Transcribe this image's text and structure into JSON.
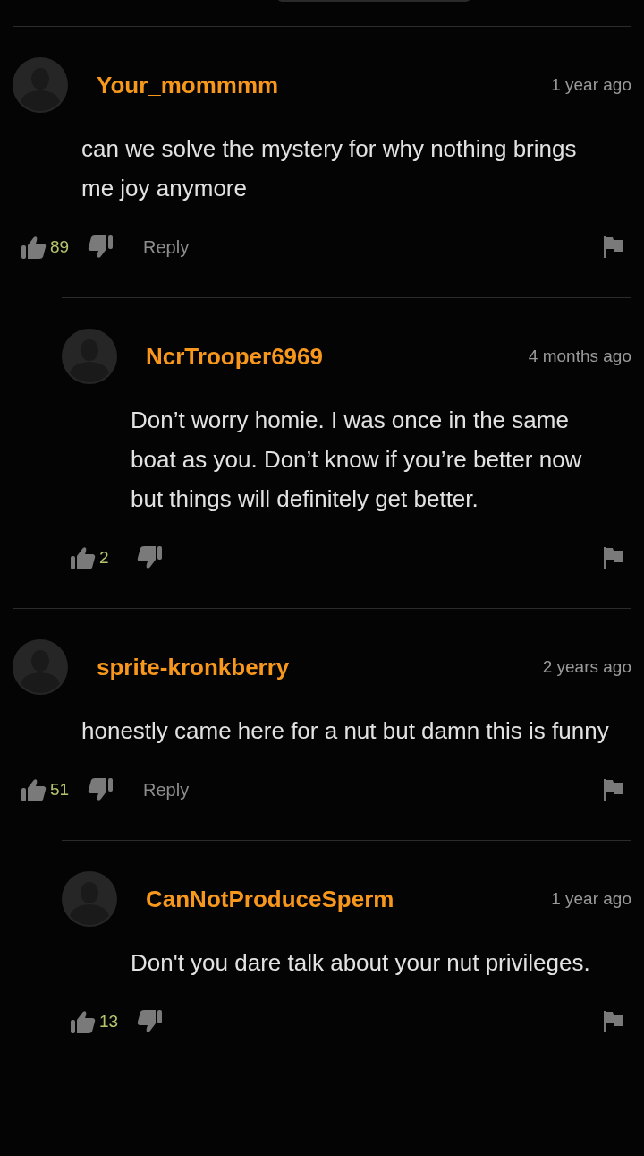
{
  "comments": [
    {
      "username": "Your_mommmm",
      "time": "1 year ago",
      "text": "can we solve the mystery for why nothing brings me joy anymore",
      "likes": "89",
      "reply_label": "Reply",
      "children": [
        {
          "username": "NcrTrooper6969",
          "time": "4 months ago",
          "text": "Don’t worry homie. I was once in the same boat as you. Don’t know if you’re better now but things will definitely get better.",
          "likes": "2"
        }
      ]
    },
    {
      "username": "sprite-kronkberry",
      "time": "2 years ago",
      "text": "honestly came here for a nut but damn this is funny",
      "likes": "51",
      "reply_label": "Reply",
      "children": [
        {
          "username": "CanNotProduceSperm",
          "time": "1 year ago",
          "text": "Don't you dare talk about your nut privileges.",
          "likes": "13"
        }
      ]
    }
  ]
}
